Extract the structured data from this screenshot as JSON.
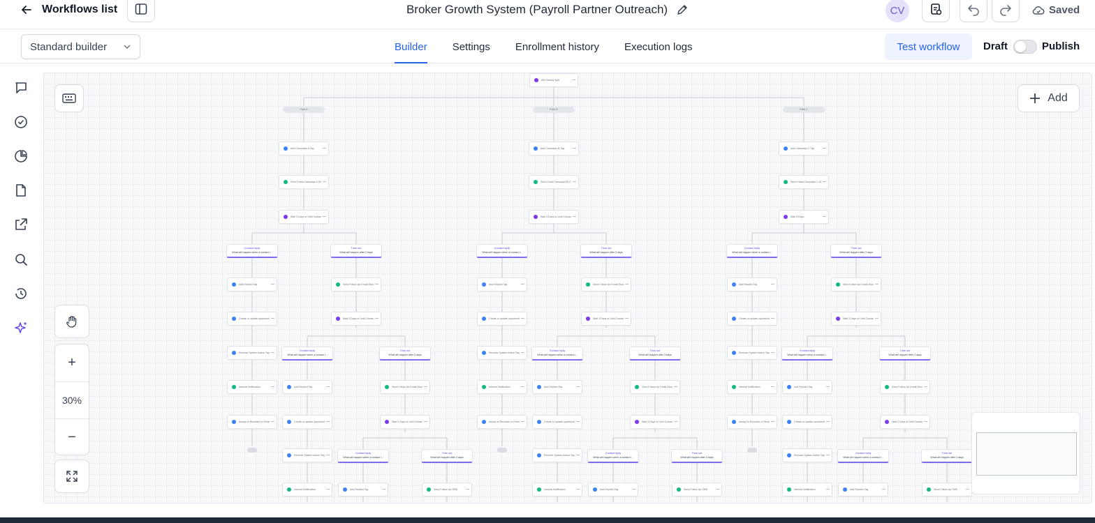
{
  "header": {
    "back_label": "Workflows list",
    "title": "Broker Growth System (Payroll Partner Outreach)",
    "avatar_initials": "CV",
    "status": "Saved"
  },
  "subbar": {
    "builder_mode": "Standard builder",
    "tabs": [
      {
        "label": "Builder",
        "active": true
      },
      {
        "label": "Settings",
        "active": false
      },
      {
        "label": "Enrollment history",
        "active": false
      },
      {
        "label": "Execution logs",
        "active": false
      }
    ],
    "test_button": "Test workflow",
    "draft_label": "Draft",
    "publish_label": "Publish",
    "publish_enabled": false
  },
  "canvas": {
    "add_label": "Add",
    "zoom": "30%"
  },
  "rail_icons": [
    "chat-icon",
    "check-circle-icon",
    "pie-chart-icon",
    "document-icon",
    "external-link-icon",
    "search-icon",
    "history-icon",
    "sparkle-icon"
  ],
  "colors": {
    "accent": "#2563eb",
    "branch_accent": "#7c6df0",
    "tag": "#3b82f6",
    "email": "#10b981",
    "wait": "#7c3aed"
  },
  "workflow": {
    "split": "A/B Testing Split",
    "paths": [
      "Path A",
      "Path B",
      "Path C"
    ],
    "branch_contact_reply": "Contact reply",
    "branch_contact_reply_sub": "What will happen when a contact r...",
    "branch_time_out": "Time out",
    "branch_time_out_sub": "What will happen after 3 days",
    "columns": [
      {
        "tag": "Add Campaign A Tag",
        "email": "Send Email Campaign A (Referral Partnership)",
        "wait": "Wait 3 Days or Until Contact Replied"
      },
      {
        "tag": "Add Campaign B Tag",
        "email": "Send Email Campaign B (Cohort Reference)",
        "wait": "Wait 3 Days or Until Contact Replied"
      },
      {
        "tag": "Add Campaign C Tag",
        "email": "Send Email Campaign C (Minimum Stack)",
        "wait": "Wait 3 Days"
      }
    ],
    "steps": {
      "replied_tag": "Add Replied Tag",
      "opportunity": "Create or update opportunity",
      "remove_tag": "Remove System Active Tag",
      "notification": "Internal Notification",
      "assign": "Assign to Recruiter to Research and Booked a Discovery Call",
      "follow_up_email": "Send Follow Up Email (Bounce)",
      "wait_reply": "Wait 3 Days or Until Contact Replied",
      "follow_up_sms": "Send Follow Up SMS",
      "end": "END"
    }
  }
}
